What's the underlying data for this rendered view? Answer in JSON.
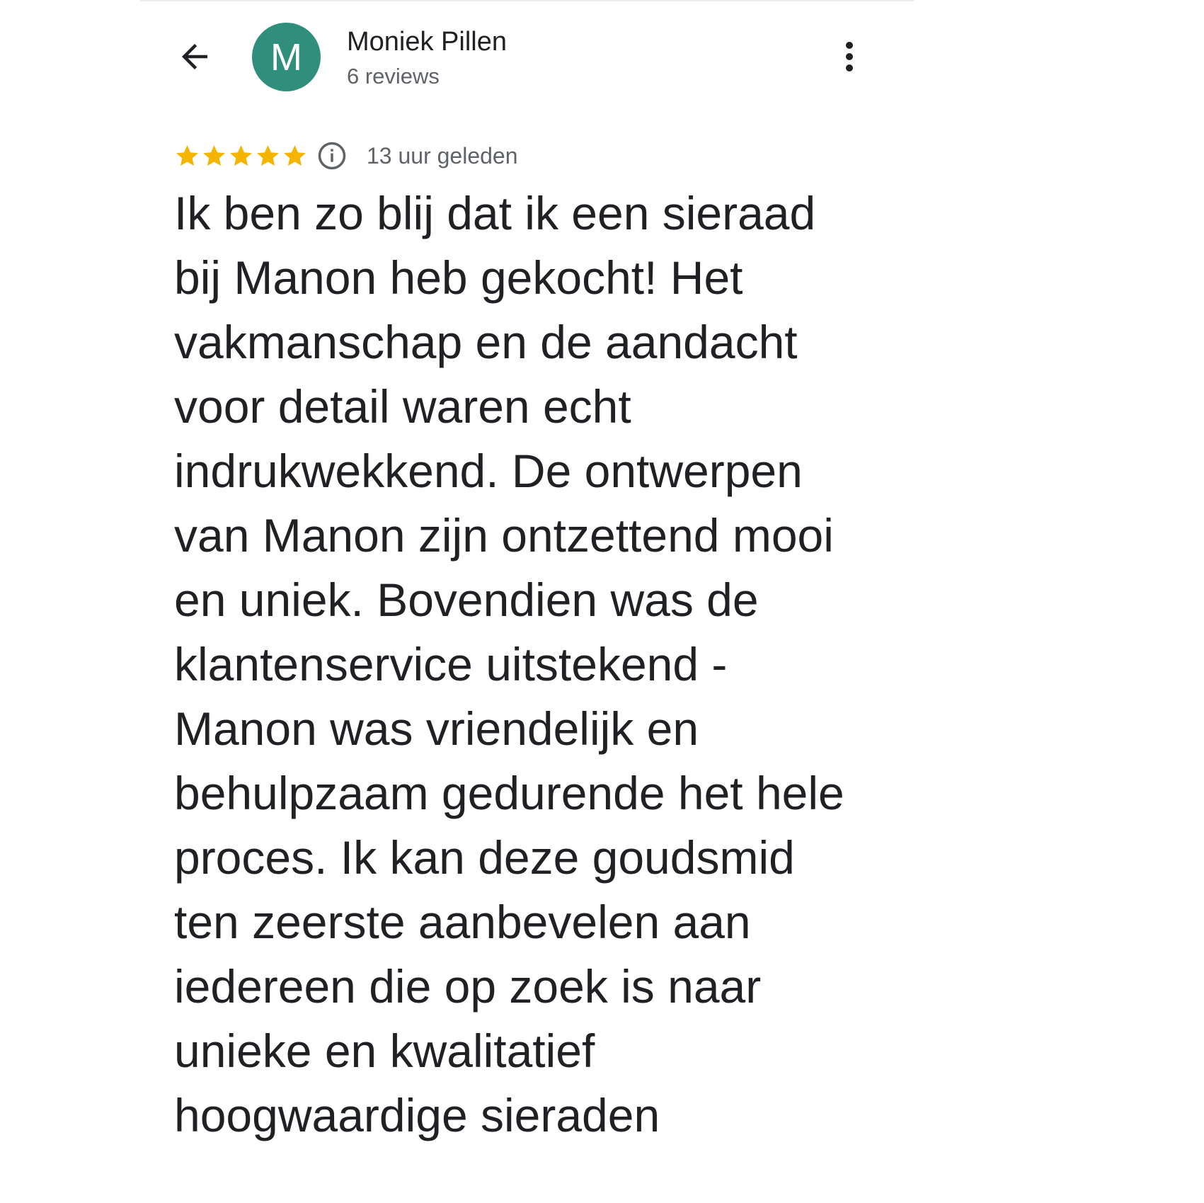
{
  "theme": {
    "avatar_color": "#2f8f7c",
    "star_color": "#f4b400",
    "text_primary": "#202124",
    "text_secondary": "#5f6368"
  },
  "header": {
    "back_icon": "arrow-left-icon",
    "avatar_letter": "M",
    "reviewer_name": "Moniek Pillen",
    "review_count": "6 reviews",
    "menu_icon": "more-vertical-icon"
  },
  "review": {
    "rating": 5,
    "rating_max": 5,
    "info_icon": "info-icon",
    "time": "13 uur geleden",
    "lines": [
      "Ik ben zo blij dat ik een sieraad",
      "bij Manon heb gekocht! Het",
      "vakmanschap en de aandacht",
      "voor detail waren echt",
      "indrukwekkend. De ontwerpen",
      "van Manon zijn ontzettend mooi",
      "en uniek. Bovendien was de",
      "klantenservice uitstekend -",
      "Manon was vriendelijk en",
      "behulpzaam gedurende het hele",
      "proces. Ik kan deze goudsmid",
      "ten zeerste aanbevelen aan",
      "iedereen die op zoek is naar",
      "unieke en kwalitatief",
      "hoogwaardige sieraden"
    ]
  }
}
